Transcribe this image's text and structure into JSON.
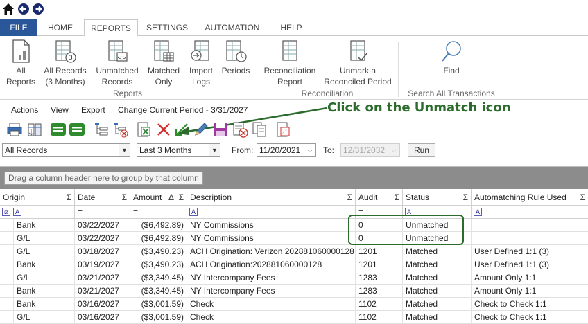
{
  "ribbon_tabs": [
    "FILE",
    "HOME",
    "REPORTS",
    "SETTINGS",
    "AUTOMATION",
    "HELP"
  ],
  "ribbon_buttons": [
    {
      "label": "All\nReports",
      "icon": "report-page-icon"
    },
    {
      "label": "All Records\n(3 Months)",
      "icon": "report-clock-icon"
    },
    {
      "label": "Unmatched\nRecords",
      "icon": "report-code-icon"
    },
    {
      "label": "Matched\nOnly",
      "icon": "report-grid-icon"
    },
    {
      "label": "Import\nLogs",
      "icon": "report-import-icon"
    },
    {
      "label": "Periods",
      "icon": "report-periods-icon"
    },
    {
      "label": "Reconciliation\nReport",
      "icon": "reconciliation-report-icon"
    },
    {
      "label": "Unmark a\nReconciled Period",
      "icon": "unmark-period-icon"
    },
    {
      "label": "Find",
      "icon": "magnifier-icon"
    }
  ],
  "ribbon_groups": [
    "Reports",
    "Reconciliation",
    "Search All Transactions"
  ],
  "actions_bar": {
    "actions": "Actions",
    "view": "View",
    "export": "Export",
    "period": "Change Current Period - 3/31/2027"
  },
  "callout": "Click on the Unmatch icon",
  "filters": {
    "records": "All Records",
    "range": "Last 3 Months",
    "from_label": "From:",
    "from_date": "11/20/2021",
    "to_label": "To:",
    "to_date": "12/31/2032",
    "run": "Run"
  },
  "grid": {
    "group_hint": "Drag a column header here to group by that column",
    "sigma": "Σ",
    "sort_up": "Δ",
    "eq": "=",
    "filter_a": "A",
    "columns": [
      "Origin",
      "Date",
      "Amount",
      "Description",
      "Audit",
      "Status",
      "Automatching Rule Used"
    ],
    "rows": [
      [
        "Bank",
        "03/22/2027",
        "($6,492.89)",
        "NY Commissions",
        "0",
        "Unmatched",
        ""
      ],
      [
        "G/L",
        "03/22/2027",
        "($6,492.89)",
        "NY Commissions",
        "0",
        "Unmatched",
        ""
      ],
      [
        "G/L",
        "03/18/2027",
        "($3,490.23)",
        "ACH Origination: Verizon 202881060000128",
        "1201",
        "Matched",
        "User Defined 1:1 (3)"
      ],
      [
        "Bank",
        "03/19/2027",
        "($3,490.23)",
        "ACH Origination:202881060000128",
        "1201",
        "Matched",
        "User Defined 1:1 (3)"
      ],
      [
        "G/L",
        "03/21/2027",
        "($3,349.45)",
        "NY Intercompany Fees",
        "1283",
        "Matched",
        "Amount Only 1:1"
      ],
      [
        "Bank",
        "03/21/2027",
        "($3,349.45)",
        "NY Intercompany Fees",
        "1283",
        "Matched",
        "Amount Only 1:1"
      ],
      [
        "Bank",
        "03/16/2027",
        "($3,001.59)",
        "Check",
        "1102",
        "Matched",
        "Check to Check 1:1"
      ],
      [
        "G/L",
        "03/16/2027",
        "($3,001.59)",
        "Check",
        "1102",
        "Matched",
        "Check to Check 1:1"
      ]
    ]
  }
}
